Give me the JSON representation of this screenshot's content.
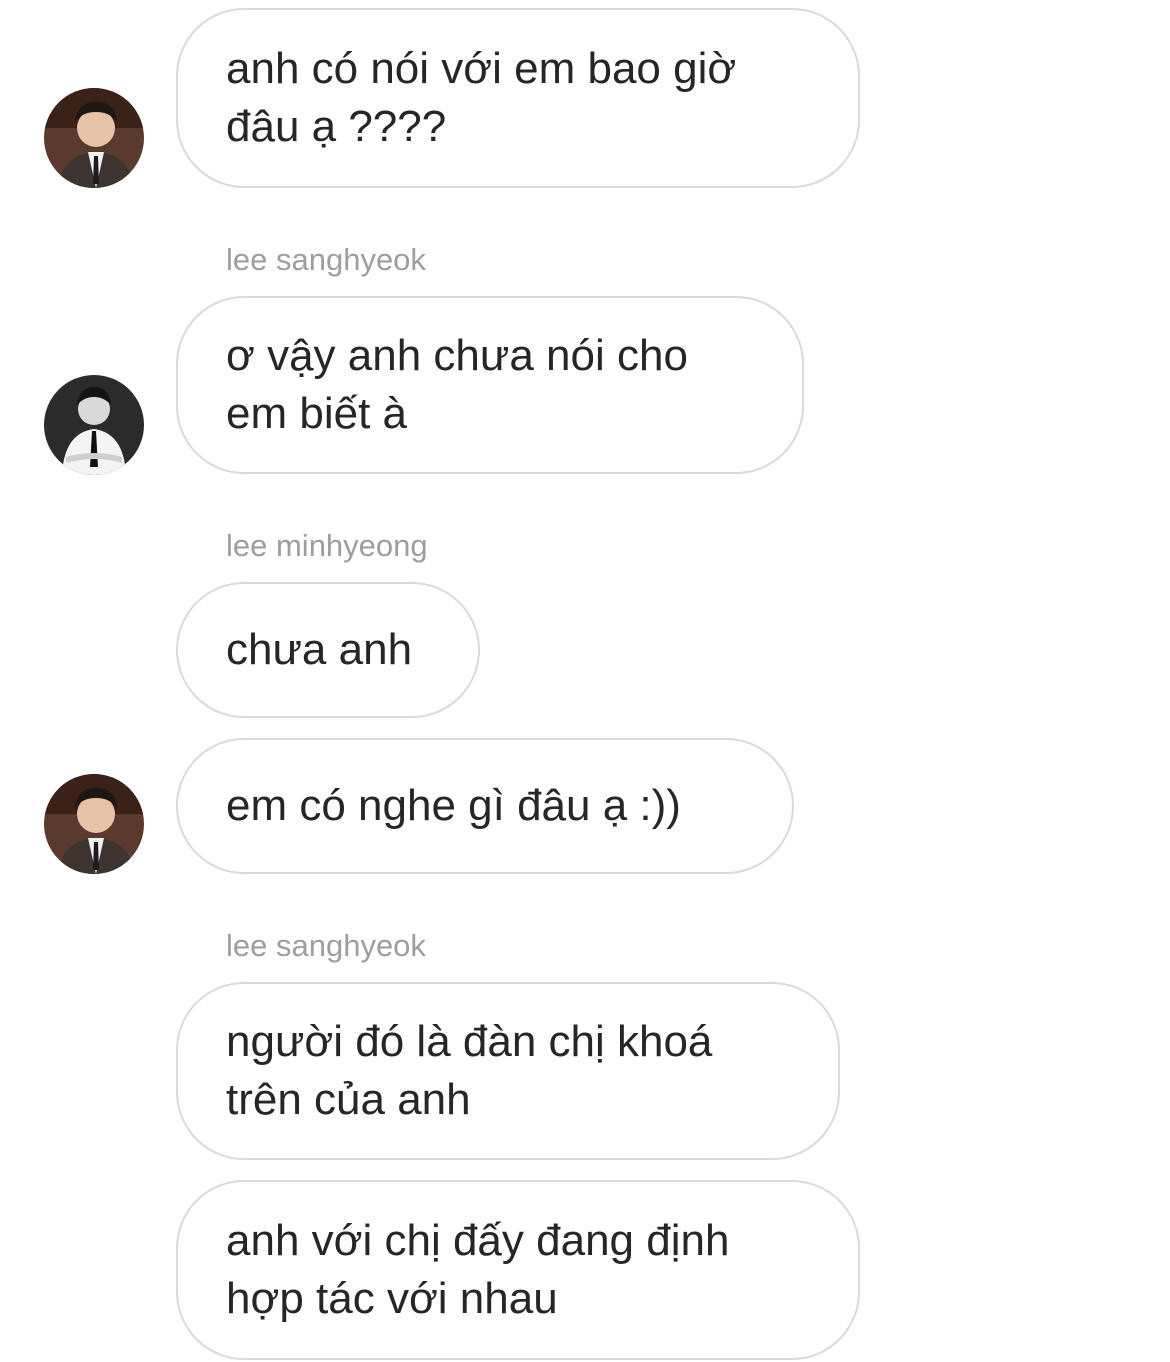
{
  "messages": [
    {
      "sender": "",
      "text": "anh có nói với em bao giờ đâu ạ ????",
      "avatar": "avatar-suit-photo"
    },
    {
      "sender": "lee sanghyeok",
      "text": "ơ vậy anh chưa nói cho em biết à",
      "avatar": "avatar-bw-photo"
    },
    {
      "sender": "lee minhyeong",
      "text": "chưa anh",
      "avatar": ""
    },
    {
      "sender": "",
      "text": "em có nghe gì đâu ạ :))",
      "avatar": "avatar-suit-photo"
    },
    {
      "sender": "lee sanghyeok",
      "text": "người đó là đàn chị khoá trên của anh",
      "avatar": ""
    },
    {
      "sender": "",
      "text": "anh với chị đấy đang định hợp tác với nhau",
      "avatar": ""
    }
  ],
  "colors": {
    "bubble_border": "#dadada",
    "bubble_text": "#262626",
    "sender_text": "#9e9e9e",
    "background": "#ffffff"
  }
}
